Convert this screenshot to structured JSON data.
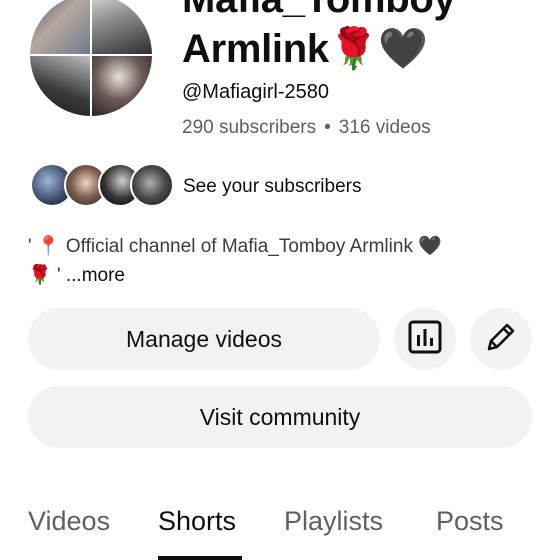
{
  "channel": {
    "name_line1": "Mafia_Tomboy",
    "name_line2": "Armlink",
    "name_emoji_rose": "🌹",
    "name_emoji_heart": "🖤",
    "handle": "@Mafiagirl-2580",
    "subscribers": "290 subscribers",
    "stats_separator": "•",
    "videos": "316 videos"
  },
  "subscribers_row": {
    "label": "See your subscribers"
  },
  "description": {
    "prefix": "' ",
    "pin_emoji": "📍",
    "line1_text": " Official channel of Mafia_Tomboy Armlink ",
    "heart_emoji": "🖤",
    "rose_emoji": "🌹",
    "line2_text": " ' ",
    "more_label": "...more"
  },
  "buttons": {
    "manage_videos": "Manage videos",
    "visit_community": "Visit community"
  },
  "tabs": [
    {
      "label": "Videos",
      "active": false
    },
    {
      "label": "Shorts",
      "active": true
    },
    {
      "label": "Playlists",
      "active": false
    },
    {
      "label": "Posts",
      "active": false
    }
  ],
  "icons": {
    "analytics": "bar-chart-icon",
    "edit": "pencil-icon"
  }
}
